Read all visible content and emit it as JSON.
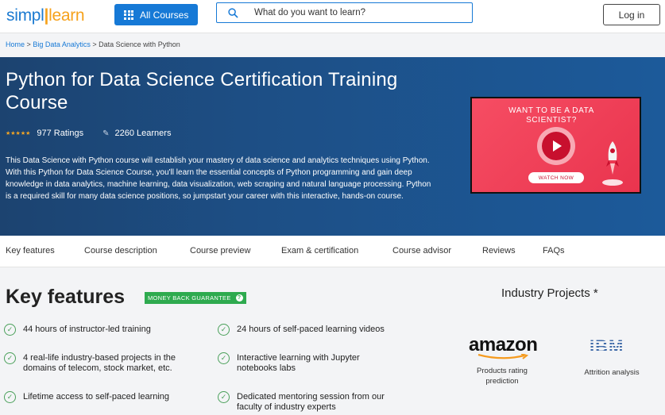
{
  "header": {
    "logo": {
      "part1": "simpl",
      "part2": "learn"
    },
    "all_courses_label": "All Courses",
    "search_placeholder": "What do you want to learn?",
    "login_label": "Log in"
  },
  "breadcrumb": {
    "items": [
      "Home",
      "Big Data Analytics",
      "Data Science with Python"
    ],
    "separator": ">"
  },
  "hero": {
    "title": "Python for Data Science Certification Training Course",
    "rating_stars": "★★★★★",
    "ratings_text": "977 Ratings",
    "learners_text": "2260 Learners",
    "description": "This Data Science with Python course will establish your mastery of data science and analytics techniques using Python. With this Python for Data Science Course, you'll learn the essential concepts of Python programming and gain deep knowledge in data analytics, machine learning, data visualization, web scraping and natural language processing. Python is a required skill for many data science positions, so jumpstart your career with this interactive, hands-on course.",
    "video": {
      "title": "WANT TO BE A DATA SCIENTIST?",
      "watch_label": "WATCH NOW"
    }
  },
  "tabs": [
    "Key features",
    "Course description",
    "Course preview",
    "Exam & certification",
    "Course advisor",
    "Reviews",
    "FAQs"
  ],
  "key_features": {
    "title": "Key features",
    "badge": "MONEY BACK GUARANTEE",
    "badge_help": "?",
    "items": [
      "44 hours of instructor-led training",
      "24 hours of self-paced learning videos",
      "4 real-life industry-based projects in the domains of telecom, stock market, etc.",
      "Interactive learning with Jupyter notebooks labs",
      "Lifetime access to self-paced learning",
      "Dedicated mentoring session from our faculty of industry experts"
    ]
  },
  "industry_projects": {
    "title": "Industry Projects *",
    "projects": [
      {
        "logo": "amazon",
        "caption": "Products rating prediction"
      },
      {
        "logo": "IBM",
        "caption": "Attrition analysis"
      }
    ]
  },
  "colors": {
    "brand_blue": "#1679d6",
    "brand_orange": "#f6a21c",
    "hero_bg": "#1d4f86",
    "guarantee_green": "#2eaa4f",
    "check_green": "#4aa05a"
  }
}
